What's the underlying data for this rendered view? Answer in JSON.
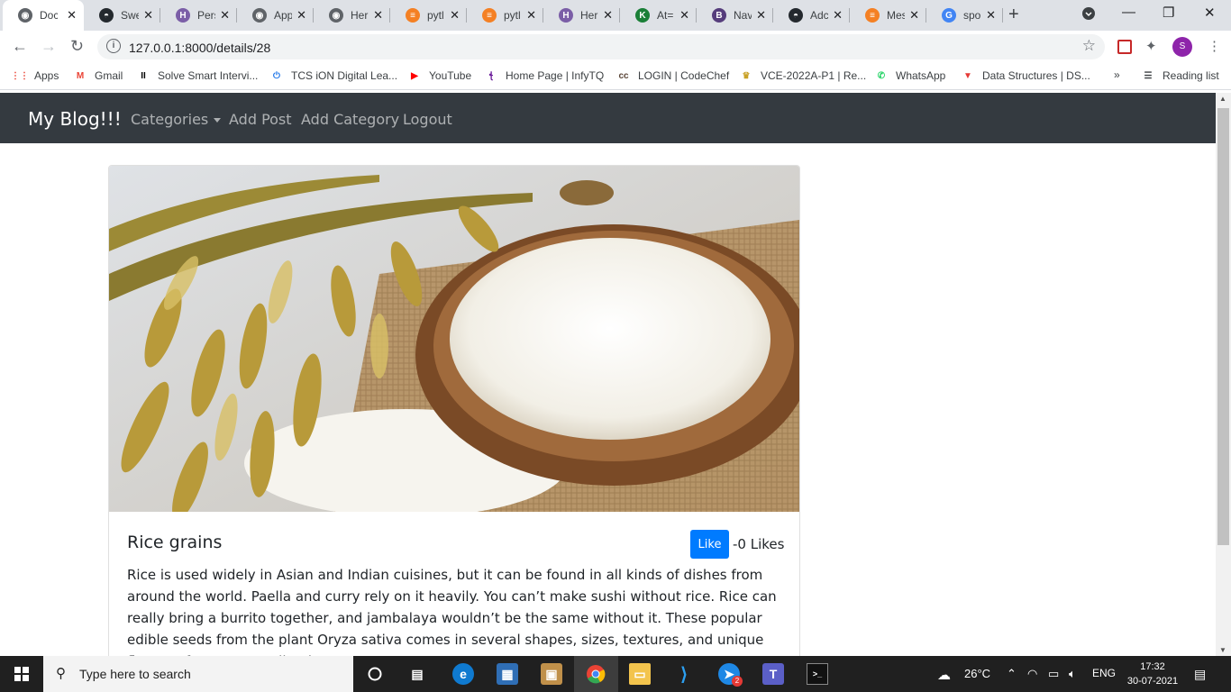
{
  "browser": {
    "tabs": [
      {
        "title": "Doc",
        "color": "#5f6368",
        "glyph": "◉"
      },
      {
        "title": "Swe",
        "color": "#24292e",
        "glyph": "◓"
      },
      {
        "title": "Pers",
        "color": "#7b5ea7",
        "glyph": "H"
      },
      {
        "title": "App",
        "color": "#5f6368",
        "glyph": "◉"
      },
      {
        "title": "Her",
        "color": "#5f6368",
        "glyph": "◉"
      },
      {
        "title": "pytl",
        "color": "#f48024",
        "glyph": "≡"
      },
      {
        "title": "pytl",
        "color": "#f48024",
        "glyph": "≡"
      },
      {
        "title": "Her",
        "color": "#7b5ea7",
        "glyph": "H"
      },
      {
        "title": "At=",
        "color": "#1a7f37",
        "glyph": "K"
      },
      {
        "title": "Nav",
        "color": "#563d7c",
        "glyph": "B"
      },
      {
        "title": "Adc",
        "color": "#24292e",
        "glyph": "◓"
      },
      {
        "title": "Mes",
        "color": "#f48024",
        "glyph": "≡"
      },
      {
        "title": "spo",
        "color": "#4285f4",
        "glyph": "G"
      }
    ],
    "url": "127.0.0.1:8000/details/28",
    "profile_initial": "S",
    "bookmarks": [
      {
        "label": "Apps",
        "color": "#ea4335",
        "glyph": "⋮⋮"
      },
      {
        "label": "Gmail",
        "color": "#ea4335",
        "glyph": "M"
      },
      {
        "label": "Solve Smart Intervi...",
        "color": "#000000",
        "glyph": "II"
      },
      {
        "label": "TCS iON Digital Lea...",
        "color": "#1a73e8",
        "glyph": "⏻"
      },
      {
        "label": "YouTube",
        "color": "#ff0000",
        "glyph": "▶"
      },
      {
        "label": "Home Page | InfyTQ",
        "color": "#6a1b9a",
        "glyph": "ꞎ"
      },
      {
        "label": "LOGIN | CodeChef",
        "color": "#5b4638",
        "glyph": "cc"
      },
      {
        "label": "VCE-2022A-P1 | Re...",
        "color": "#c9a227",
        "glyph": "♛"
      },
      {
        "label": "WhatsApp",
        "color": "#25d366",
        "glyph": "✆"
      },
      {
        "label": "Data Structures | DS...",
        "color": "#e53935",
        "glyph": "▼"
      }
    ],
    "more_label": "»",
    "reading_list": "Reading list"
  },
  "site": {
    "brand": "My Blog!!!",
    "nav": [
      "Categories",
      "Add Post",
      "Add Category",
      "Logout"
    ]
  },
  "post": {
    "title": "Rice grains",
    "like_label": "Like",
    "likes_text": "-0 Likes",
    "body": "Rice is used widely in Asian and Indian cuisines, but it can be found in all kinds of dishes from around the world. Paella and curry rely on it heavily. You can’t make sushi without rice. Rice can really bring a burrito together, and jambalaya wouldn’t be the same without it. These popular edible seeds from the plant Oryza sativa comes in several shapes, sizes, textures, and unique flavors. If you were to list the"
  },
  "taskbar": {
    "search_placeholder": "Type here to search",
    "temperature": "26°C",
    "language": "ENG",
    "time": "17:32",
    "date": "30-07-2021",
    "teams_badge": "2"
  }
}
